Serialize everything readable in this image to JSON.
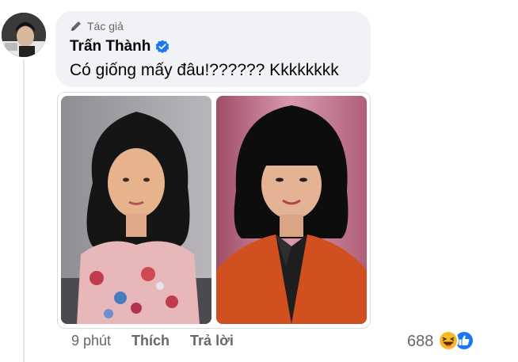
{
  "comment": {
    "badge_label": "Tác giả",
    "author_name": "Trấn Thành",
    "text": "Có giống mấy đâu!?????? Kkkkkkkk",
    "time": "9 phút",
    "like_label": "Thích",
    "reply_label": "Trả lời",
    "reaction_count": "688",
    "reactions": [
      "haha-icon",
      "like-icon"
    ]
  },
  "colors": {
    "bubble_bg": "#f0f2f5",
    "verified_blue": "#1877f2",
    "muted_text": "#65676b",
    "haha_yellow": "#f7b928"
  }
}
